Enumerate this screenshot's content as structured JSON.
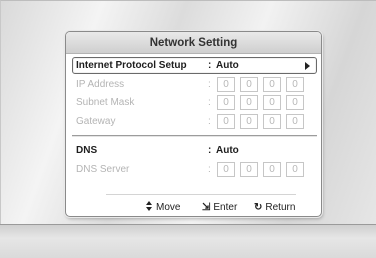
{
  "dialog": {
    "title": "Network Setting",
    "rows": [
      {
        "label": "Internet Protocol Setup",
        "colon": ":",
        "value": "Auto"
      },
      {
        "label": "IP Address",
        "colon": ":",
        "octets": [
          "0",
          "0",
          "0",
          "0"
        ]
      },
      {
        "label": "Subnet Mask",
        "colon": ":",
        "octets": [
          "0",
          "0",
          "0",
          "0"
        ]
      },
      {
        "label": "Gateway",
        "colon": ":",
        "octets": [
          "0",
          "0",
          "0",
          "0"
        ]
      },
      {
        "label": "DNS",
        "colon": ":",
        "value": "Auto"
      },
      {
        "label": "DNS Server",
        "colon": ":",
        "octets": [
          "0",
          "0",
          "0",
          "0"
        ]
      }
    ],
    "footer": {
      "move": "Move",
      "enter": "Enter",
      "return": "Return"
    }
  },
  "icons": {
    "move": "up-down-arrows-icon",
    "enter": "enter-icon",
    "return": "return-icon",
    "expand": "right-triangle-icon"
  }
}
